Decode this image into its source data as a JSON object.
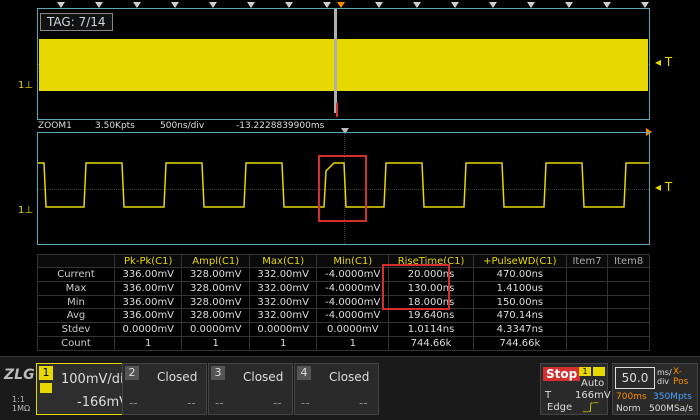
{
  "tag": "TAG: 7/14",
  "channel_marker": "1",
  "trigger_marker": "T",
  "zoom": {
    "label": "ZOOM1",
    "points": "3.50Kpts",
    "timebase": "500ns/div",
    "offset": "-13.2228839900ms"
  },
  "measurements": {
    "headers": [
      "",
      "Pk-Pk(C1)",
      "Ampl(C1)",
      "Max(C1)",
      "Min(C1)",
      "RiseTime(C1)",
      "+PulseWD(C1)",
      "Item7",
      "Item8"
    ],
    "rows": [
      {
        "label": "Current",
        "values": [
          "336.00mV",
          "328.00mV",
          "332.00mV",
          "-4.0000mV",
          "20.000ns",
          "470.00ns",
          "",
          ""
        ]
      },
      {
        "label": "Max",
        "values": [
          "336.00mV",
          "328.00mV",
          "332.00mV",
          "-4.0000mV",
          "130.00ns",
          "1.4100us",
          "",
          ""
        ]
      },
      {
        "label": "Min",
        "values": [
          "336.00mV",
          "328.00mV",
          "332.00mV",
          "-4.0000mV",
          "18.000ns",
          "150.00ns",
          "",
          ""
        ]
      },
      {
        "label": "Avg",
        "values": [
          "336.00mV",
          "328.00mV",
          "332.00mV",
          "-4.0000mV",
          "19.640ns",
          "470.14ns",
          "",
          ""
        ]
      },
      {
        "label": "Stdev",
        "values": [
          "0.0000mV",
          "0.0000mV",
          "0.0000mV",
          "0.0000mV",
          "1.0114ns",
          "4.3347ns",
          "",
          ""
        ]
      },
      {
        "label": "Count",
        "values": [
          "1",
          "1",
          "1",
          "1",
          "744.66k",
          "744.66k",
          "",
          ""
        ]
      }
    ]
  },
  "bottom": {
    "ratio_top": "1:1",
    "ratio_bottom": "1MΩ",
    "ch1": {
      "num": "1",
      "scale": "100mV/div",
      "offset": "-166mV"
    },
    "ch2": {
      "num": "2",
      "state": "Closed",
      "dash": "--"
    },
    "ch3": {
      "num": "3",
      "state": "Closed",
      "dash": "--"
    },
    "ch4": {
      "num": "4",
      "state": "Closed",
      "dash": "--"
    },
    "run": {
      "state": "Stop",
      "mode": "Auto",
      "trig_label": "T",
      "trig_level": "166mV",
      "edge": "Edge"
    },
    "horizontal": {
      "timebase": "50.0",
      "timebase_unit_top": "ms/",
      "timebase_unit_bottom": "div",
      "xpos_label": "X-Pos",
      "time": "700ms",
      "rate": "350Mpts",
      "norm": "Norm",
      "sample": "500MSa/s"
    }
  },
  "colors": {
    "ch1": "#e6d800",
    "grid": "#5aa9b8",
    "stop": "#d32f2f",
    "orange": "#ff8c00"
  }
}
